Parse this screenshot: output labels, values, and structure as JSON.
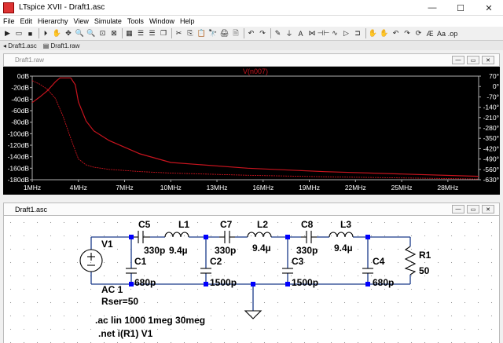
{
  "window": {
    "title": "LTspice XVII - Draft1.asc",
    "controls": [
      "—",
      "☐",
      "✕"
    ]
  },
  "menu": [
    "File",
    "Edit",
    "Hierarchy",
    "View",
    "Simulate",
    "Tools",
    "Window",
    "Help"
  ],
  "toolbar": {
    "icons": [
      "open-folder-icon",
      "new-schematic-icon",
      "save-icon",
      "run-icon",
      "halt-icon",
      "pan-icon",
      "zoom-in-icon",
      "zoom-out-icon",
      "zoom-fit-icon",
      "zoom-cancel-icon",
      "autorange-icon",
      "tile-horizontal-icon",
      "tile-vertical-icon",
      "cascade-icon",
      "cut-icon",
      "copy-icon",
      "paste-icon",
      "find-icon",
      "print-icon",
      "print-preview-icon",
      "undo-icon",
      "redo-icon",
      "wire-icon",
      "ground-icon",
      "label-icon",
      "resistor-icon",
      "capacitor-icon",
      "inductor-icon",
      "diode-icon",
      "component-icon",
      "move-icon",
      "drag-icon",
      "undo2-icon",
      "redo2-icon",
      "rotate-icon",
      "mirror-icon",
      "text-icon",
      "spice-directive-icon"
    ],
    "glyphs": [
      "▶",
      "▭",
      "■",
      "⏵",
      "✋",
      "✥",
      "🔍",
      "🔍",
      "⊡",
      "⊠",
      "▦",
      "☰",
      "☰",
      "❐",
      "✂",
      "⎘",
      "📋",
      "🔭",
      "🖨",
      "🗎",
      "↶",
      "↷",
      "✎",
      "⏚",
      "A",
      "⋈",
      "⊣⊢",
      "∿",
      "▷",
      "⊐",
      "✋",
      "✋",
      "↶",
      "↷",
      "⟳",
      "Æ",
      "Aa",
      ".op"
    ]
  },
  "tabs": [
    "Draft1.asc",
    "Draft1.raw"
  ],
  "waveform_window": {
    "title": "Draft1.raw",
    "trace_label": "V(n007)",
    "trace_color": "#c8141e",
    "axis_color": "#b0b0b0",
    "mdi_controls": [
      "—",
      "▭",
      "✕"
    ]
  },
  "schematic_window": {
    "title": "Draft1.asc",
    "mdi_controls": [
      "—",
      "▭",
      "✕"
    ],
    "components": [
      {
        "ref": "V1"
      },
      {
        "ref": "C5",
        "value": "330p"
      },
      {
        "ref": "L1",
        "value": "9.4µ"
      },
      {
        "ref": "C7",
        "value": "330p"
      },
      {
        "ref": "L2",
        "value": "9.4µ"
      },
      {
        "ref": "C8",
        "value": "330p"
      },
      {
        "ref": "L3",
        "value": "9.4µ"
      },
      {
        "ref": "C1",
        "value": "680p"
      },
      {
        "ref": "C2",
        "value": "1500p"
      },
      {
        "ref": "C3",
        "value": "1500p"
      },
      {
        "ref": "C4",
        "value": "680p"
      },
      {
        "ref": "R1",
        "value": "50"
      }
    ],
    "source_params": [
      "AC 1",
      "Rser=50"
    ],
    "directives": [
      ".ac lin 1000 1meg 30meg",
      ".net i(R1) V1"
    ]
  },
  "chart_data": {
    "type": "line",
    "title": "V(n007)",
    "x_ticks": [
      "1MHz",
      "4MHz",
      "7MHz",
      "10MHz",
      "13MHz",
      "16MHz",
      "19MHz",
      "22MHz",
      "25MHz",
      "28MHz"
    ],
    "xlim": [
      1,
      30
    ],
    "y_left_ticks": [
      "0dB",
      "-20dB",
      "-40dB",
      "-60dB",
      "-80dB",
      "-100dB",
      "-120dB",
      "-140dB",
      "-160dB",
      "-180dB"
    ],
    "ylim_left": [
      -180,
      0
    ],
    "y_right_ticks": [
      "70°",
      "0°",
      "-70°",
      "-140°",
      "-210°",
      "-280°",
      "-350°",
      "-420°",
      "-490°",
      "-560°",
      "-630°"
    ],
    "ylim_right": [
      -630,
      70
    ],
    "series": [
      {
        "name": "magnitude",
        "x": [
          1,
          1.5,
          2,
          2.5,
          2.8,
          3,
          3.5,
          3.8,
          4,
          4.5,
          5,
          6,
          8,
          10,
          15,
          20,
          25,
          30
        ],
        "y": [
          -46,
          -36,
          -25,
          -10,
          -3,
          -3,
          -3,
          -15,
          -45,
          -78,
          -95,
          -112,
          -135,
          -150,
          -160,
          -166,
          -170,
          -174
        ]
      },
      {
        "name": "phase",
        "x": [
          1,
          1.5,
          2,
          2.5,
          3,
          3.5,
          4,
          4.5,
          5,
          6,
          8,
          10,
          15,
          20,
          25,
          30
        ],
        "y": [
          40,
          15,
          -20,
          -80,
          -200,
          -350,
          -490,
          -530,
          -545,
          -560,
          -575,
          -585,
          -600,
          -610,
          -618,
          -625
        ]
      }
    ]
  }
}
